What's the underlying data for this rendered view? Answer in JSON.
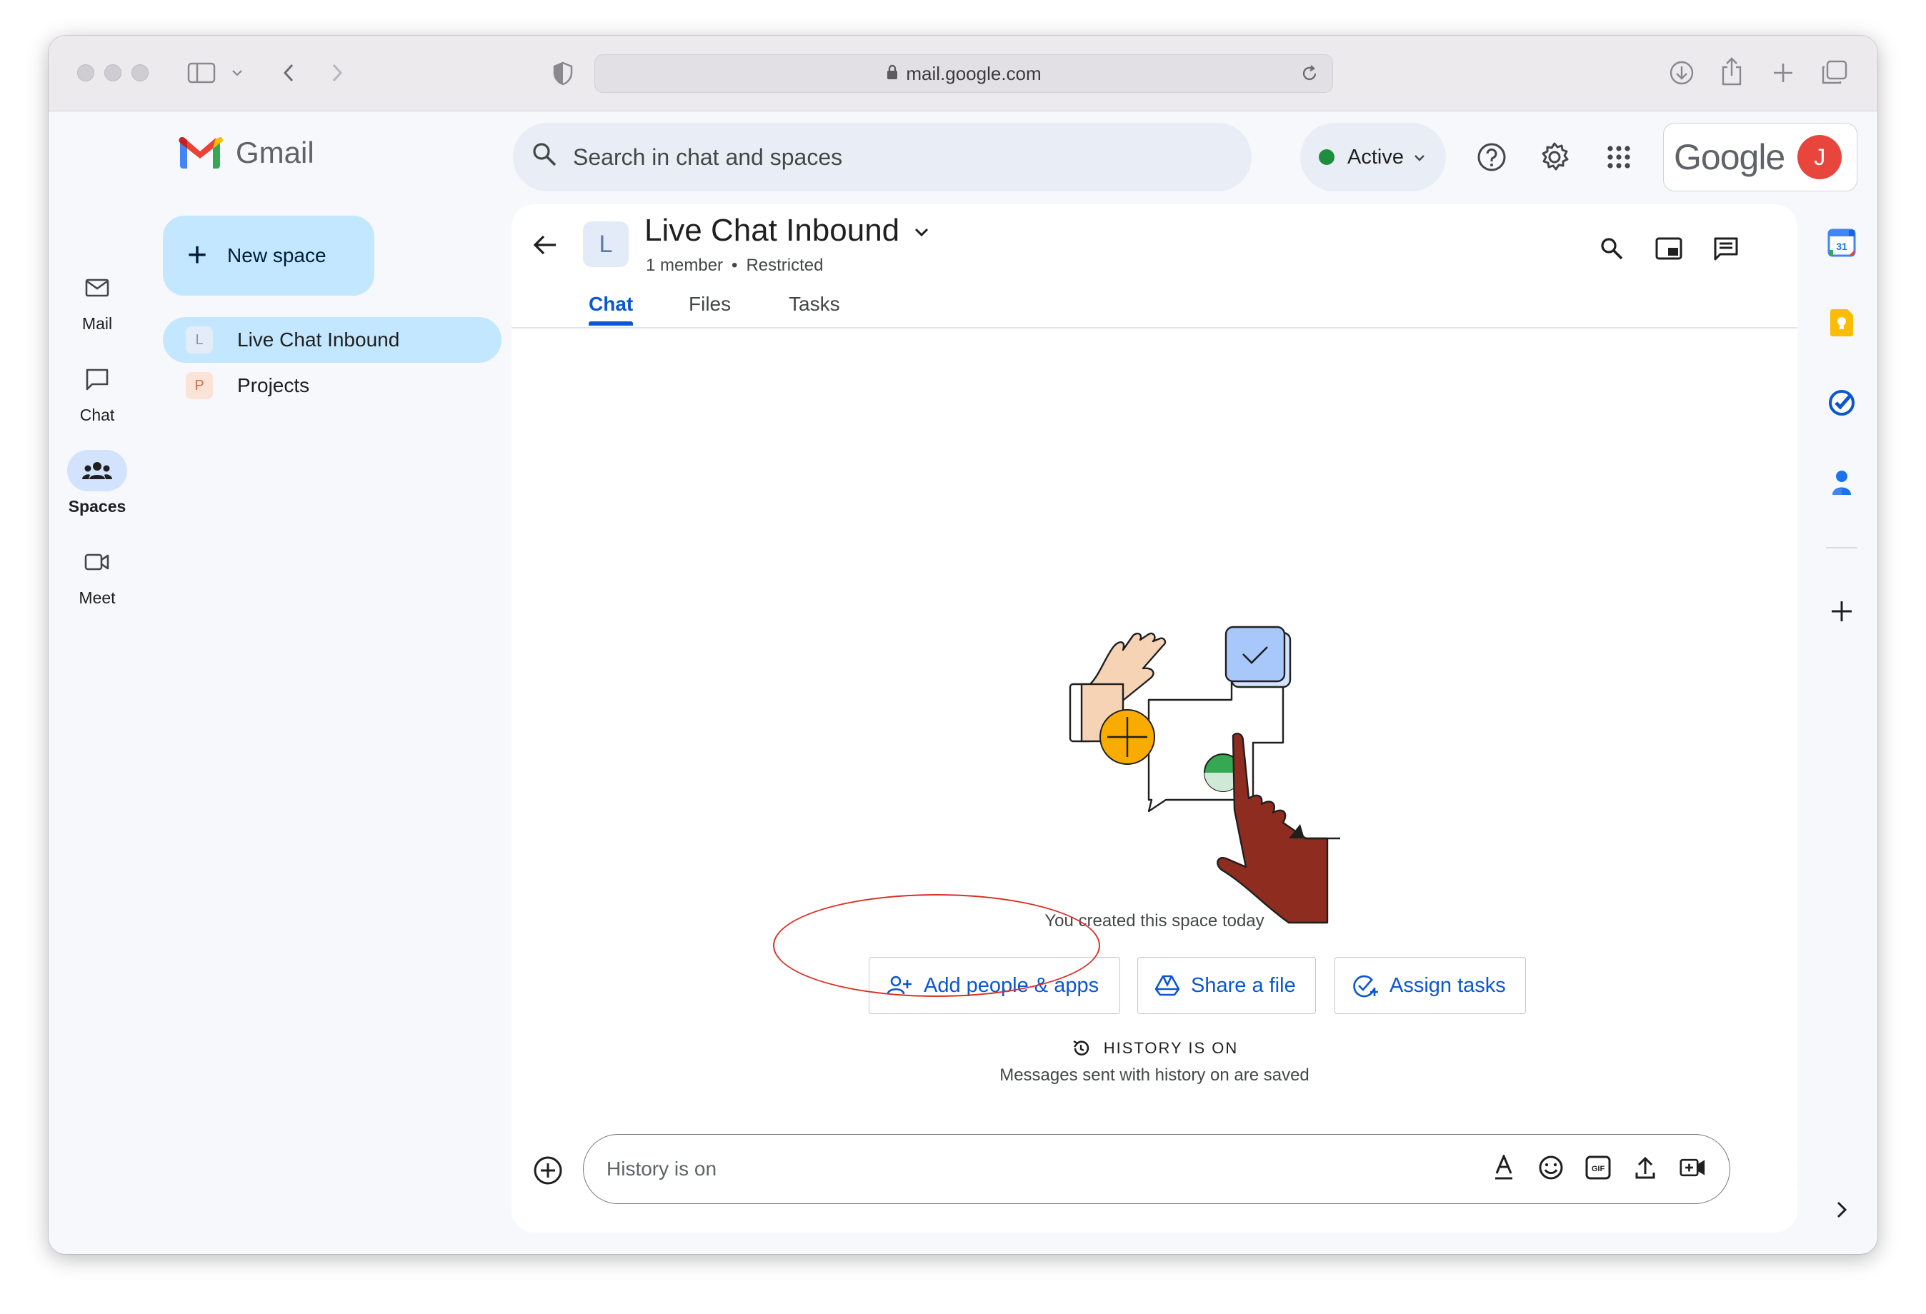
{
  "browser": {
    "url": "mail.google.com"
  },
  "app": {
    "name": "Gmail",
    "account_brand": "Google",
    "avatar_initial": "J"
  },
  "rail": {
    "items": [
      {
        "label": "Mail",
        "icon": "mail-icon"
      },
      {
        "label": "Chat",
        "icon": "chat-icon"
      },
      {
        "label": "Spaces",
        "icon": "spaces-icon",
        "active": true
      },
      {
        "label": "Meet",
        "icon": "meet-icon"
      }
    ]
  },
  "nav": {
    "new_space_label": "New space",
    "spaces": [
      {
        "initial": "L",
        "name": "Live Chat Inbound",
        "active": true
      },
      {
        "initial": "P",
        "name": "Projects"
      }
    ]
  },
  "header": {
    "search_placeholder": "Search in chat and spaces",
    "status": "Active"
  },
  "room": {
    "initial": "L",
    "title": "Live Chat Inbound",
    "members": "1 member",
    "access": "Restricted",
    "tabs": [
      "Chat",
      "Files",
      "Tasks"
    ],
    "active_tab": "Chat"
  },
  "empty_state": {
    "created_text": "You created this space today",
    "actions": [
      {
        "label": "Add people & apps",
        "icon": "add-person-icon"
      },
      {
        "label": "Share a file",
        "icon": "drive-icon"
      },
      {
        "label": "Assign tasks",
        "icon": "add-task-icon"
      }
    ],
    "history_title": "HISTORY IS ON",
    "history_sub": "Messages sent with history on are saved"
  },
  "compose": {
    "placeholder": "History is on",
    "icons": [
      "format-text-icon",
      "emoji-icon",
      "gif-icon",
      "upload-icon",
      "video-call-icon"
    ]
  },
  "colors": {
    "accent_blue": "#0b57d0",
    "selected_bg": "#c2e7ff",
    "active_status": "#1e8e3e",
    "highlight_ring": "#d93025"
  }
}
